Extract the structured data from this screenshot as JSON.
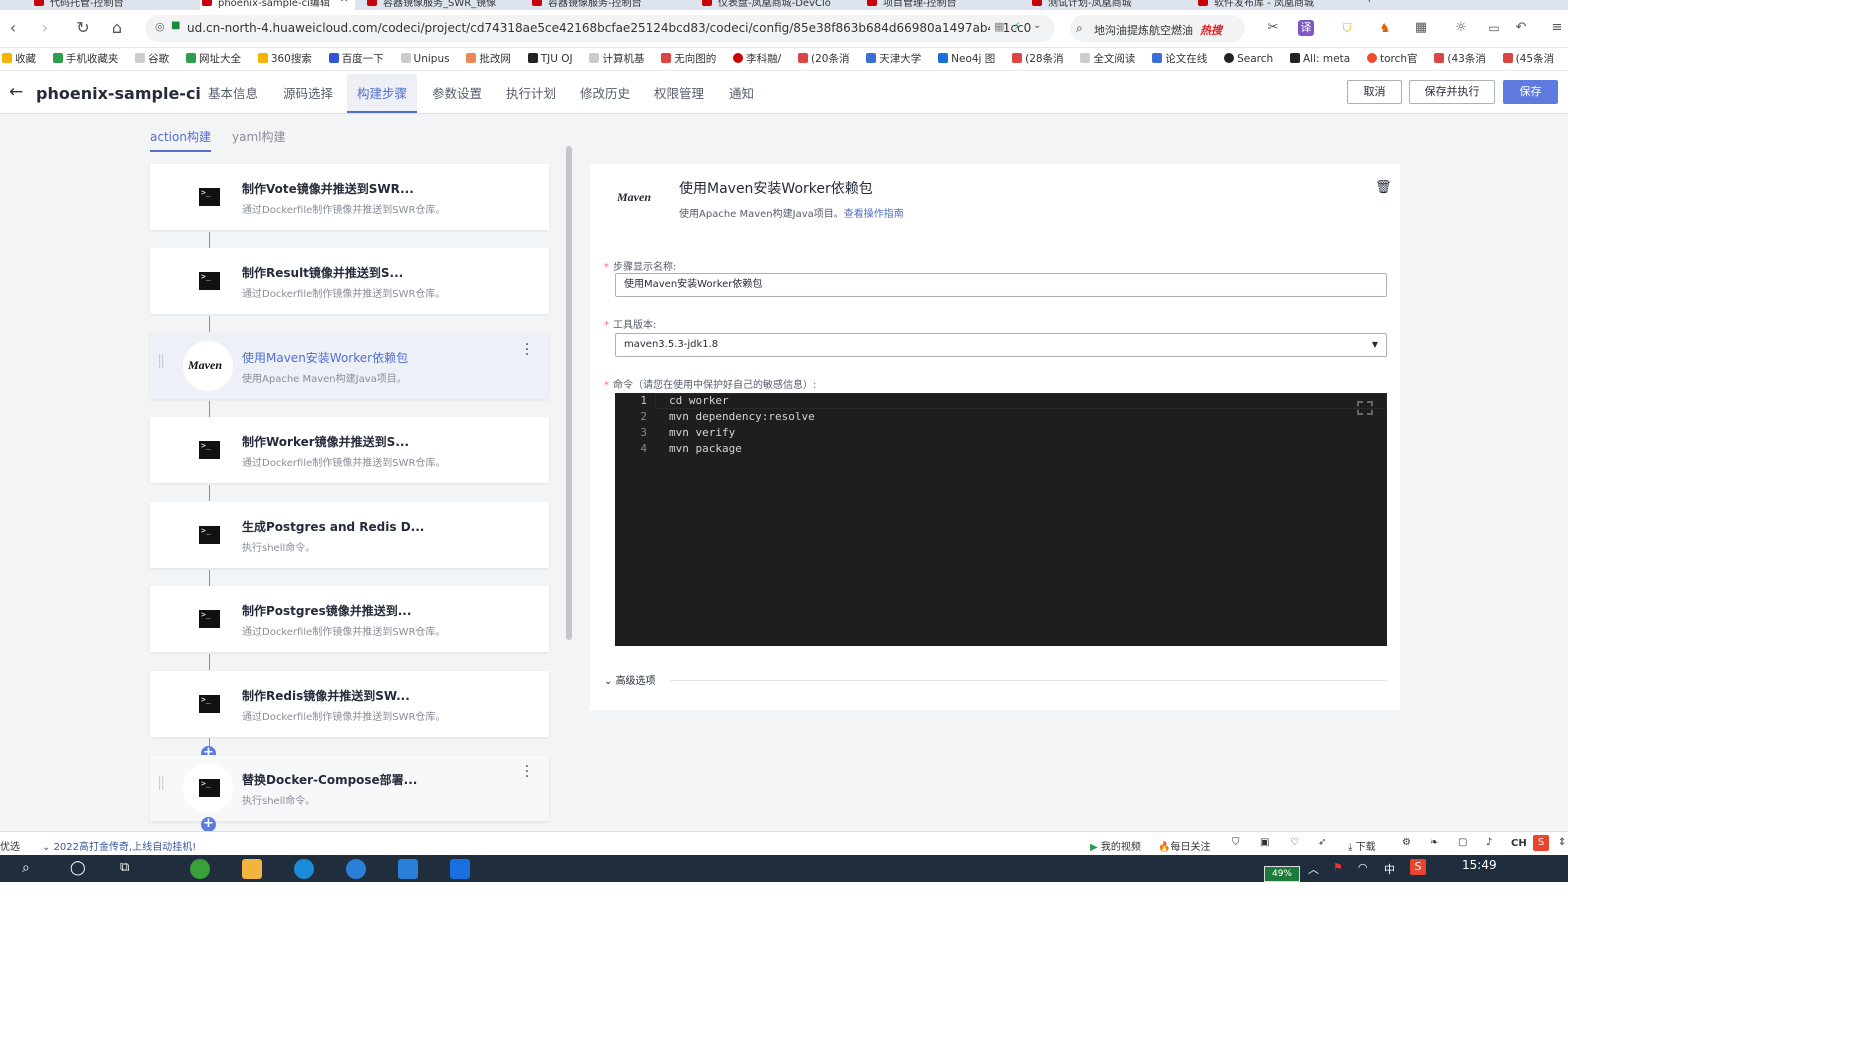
{
  "browser": {
    "tabs": [
      "代码托管-控制台",
      "phoenix-sample-ci编辑",
      "容器镜像服务_SWR_镜像",
      "容器镜像服务-控制台",
      "仪表盘-凤凰商城-DevClo",
      "项目管理-控制台",
      "测试计划-凤凰商城",
      "软件发布库 - 凤凰商城"
    ],
    "url": "ud.cn-north-4.huaweicloud.com/codeci/project/cd74318ae5ce42168bcfae25124bcd83/codeci/config/85e38f863b684d66980a1497ab431cc0",
    "search_text": "地沟油提炼航空燃油",
    "search_badge": "热搜",
    "bookmarks": [
      "收藏",
      "手机收藏夹",
      "谷歌",
      "网址大全",
      "360搜索",
      "百度一下",
      "Unipus",
      "批改网",
      "TJU OJ",
      "计算机基",
      "无向图的",
      "李科融/",
      "(20条消",
      "天津大学",
      "Neo4j 图",
      "(28条消",
      "全文阅读",
      "论文在线",
      "Search",
      "All: meta",
      "torch官",
      "(43条消",
      "(45条消",
      "»"
    ]
  },
  "header": {
    "title": "phoenix-sample-ci",
    "tabs": [
      "基本信息",
      "源码选择",
      "构建步骤",
      "参数设置",
      "执行计划",
      "修改历史",
      "权限管理",
      "通知"
    ],
    "active_tab": 2,
    "cancel_label": "取消",
    "save_run_label": "保存并执行",
    "save_label": "保存"
  },
  "subtabs": {
    "action": "action构建",
    "yaml": "yaml构建"
  },
  "steps": [
    {
      "title": "制作Vote镜像并推送到SWR...",
      "desc": "通过Dockerfile制作镜像并推送到SWR仓库。",
      "icon": "terminal-icon"
    },
    {
      "title": "制作Result镜像并推送到S...",
      "desc": "通过Dockerfile制作镜像并推送到SWR仓库。",
      "icon": "terminal-icon"
    },
    {
      "title": "使用Maven安装Worker依赖包",
      "desc": "使用Apache Maven构建Java项目。",
      "icon": "maven-logo",
      "logo_text": "Maven"
    },
    {
      "title": "制作Worker镜像并推送到S...",
      "desc": "通过Dockerfile制作镜像并推送到SWR仓库。",
      "icon": "terminal-icon"
    },
    {
      "title": "生成Postgres and Redis D...",
      "desc": "执行shell命令。",
      "icon": "terminal-icon"
    },
    {
      "title": "制作Postgres镜像并推送到...",
      "desc": "通过Dockerfile制作镜像并推送到SWR仓库。",
      "icon": "terminal-icon"
    },
    {
      "title": "制作Redis镜像并推送到SW...",
      "desc": "通过Dockerfile制作镜像并推送到SWR仓库。",
      "icon": "terminal-icon"
    },
    {
      "title": "替换Docker-Compose部署...",
      "desc": "执行shell命令。",
      "icon": "terminal-icon"
    }
  ],
  "detail": {
    "logo": "Maven",
    "title": "使用Maven安装Worker依赖包",
    "desc": "使用Apache Maven构建Java项目。",
    "link": "查看操作指南",
    "name_label": "步骤显示名称:",
    "name_value": "使用Maven安装Worker依赖包",
    "version_label": "工具版本:",
    "version_value": "maven3.5.3-jdk1.8",
    "command_label": "命令（请您在使用中保护好自己的敏感信息）:",
    "code_lines": [
      "cd worker",
      "mvn dependency:resolve",
      "mvn verify",
      "mvn package"
    ],
    "advanced_label": "高级选项"
  },
  "statusbar": {
    "left_text": "优选",
    "news": "2022高打金传奇,上线自动挂机!",
    "video": "我的视频",
    "follow": "每日关注",
    "download": "下载",
    "ime": "CH"
  },
  "taskbar": {
    "time": "15:49",
    "battery": "49%",
    "lang": "中"
  }
}
